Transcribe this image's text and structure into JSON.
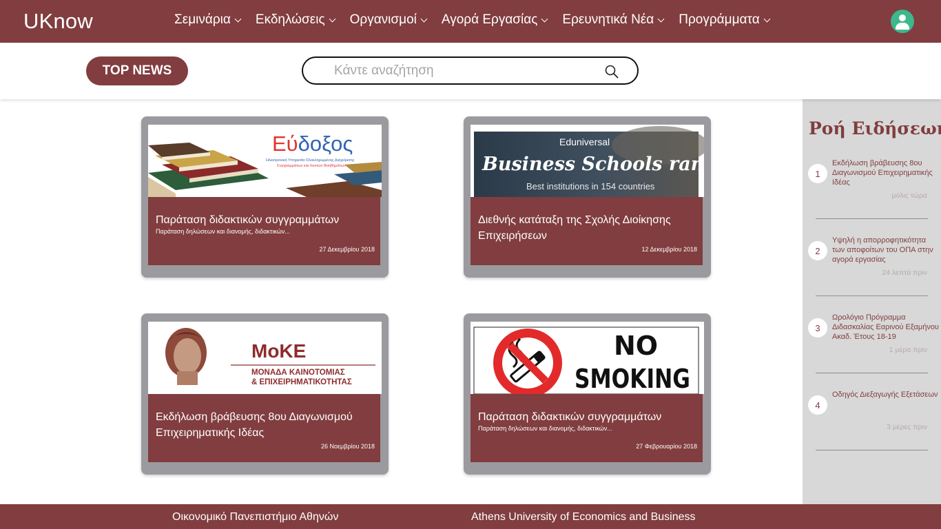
{
  "app": {
    "logo": "UKnow"
  },
  "nav": {
    "items": [
      {
        "label": "Σεμινάρια"
      },
      {
        "label": "Εκδηλώσεις"
      },
      {
        "label": "Οργανισμοί"
      },
      {
        "label": "Αγορά Εργασίας"
      },
      {
        "label": "Ερευνητικά Νέα"
      },
      {
        "label": "Προγράμματα"
      }
    ]
  },
  "subbar": {
    "top_news_label": "TOP NEWS",
    "search_placeholder": "Κάντε αναζήτηση"
  },
  "cards": [
    {
      "title": "Παράταση διδακτικών συγγραμμάτων",
      "desc": "Παράταση δηλώσεων και διανομής, διδακτικών...",
      "date": "27 Δεκεμβρίου 2018",
      "image": {
        "brand": "Εύδοξος",
        "line1": "Ηλεκτρονική Υπηρεσία Ολοκληρωμένης Διαχείρισης",
        "line2": "Συγγραμμάτων και Λοιπών Βοηθημάτων"
      }
    },
    {
      "title": "Διεθνής κατάταξη της Σχολής Διοίκησης Επιχειρήσεων",
      "desc": "",
      "date": "12 Δεκεμβρίου 2018",
      "image": {
        "top": "Eduniversal",
        "main": "Business Schools ranking",
        "sub": "Best institutions in 154 countries"
      }
    },
    {
      "title": "Εκδήλωση βράβευσης 8ου Διαγωνισμού Επιχειρηματικής Ιδέας",
      "desc": "",
      "date": "26 Νοεμβρίου 2018",
      "image": {
        "brand": "MoKE",
        "line1": "ΜΟΝΑΔΑ ΚΑΙΝΟΤΟΜΙΑΣ",
        "line2": "& ΕΠΙΧΕΙΡΗΜΑΤΙΚΟΤΗΤΑΣ"
      }
    },
    {
      "title": "Παράταση διδακτικών συγγραμμάτων",
      "desc": "Παράταση δηλώσεων και διανομής, διδακτικών...",
      "date": "27 Φεβρουαρίου 2018",
      "image": {
        "line1": "NO",
        "line2": "SMOKING"
      }
    }
  ],
  "feed": {
    "title": "Ροή Ειδήσεων",
    "items": [
      {
        "num": "1",
        "text": "Εκδήλωση βράβευσης 8ου Διαγωνισμού Επιχειρηματικής Ιδέας",
        "time": "μόλις τώρα"
      },
      {
        "num": "2",
        "text": "Υψηλή η απορροφητικότητα των αποφοίτων του ΟΠΑ στην αγορά εργασίας",
        "time": "24 λεπτά πριν"
      },
      {
        "num": "3",
        "text": "Ωρολόγιο Πρόγραμμα Διδασκαλίας Εαρινού Εξαμήνου Ακαδ. Έτους 18-19",
        "time": "1 μέρα πριν"
      },
      {
        "num": "4",
        "text": "Οδηγός Διεξαγωγής Εξετάσεων",
        "time": "3 μέρες πριν"
      }
    ]
  },
  "footer": {
    "left": "Οικονομικό Πανεπιστήμιο Αθηνών",
    "right": "Athens University of Economics and Business"
  },
  "colors": {
    "brand": "#813d3f",
    "avatar": "#3cb88c",
    "sidebar": "#d8d8d8",
    "card_frame": "#9b9a9f"
  }
}
